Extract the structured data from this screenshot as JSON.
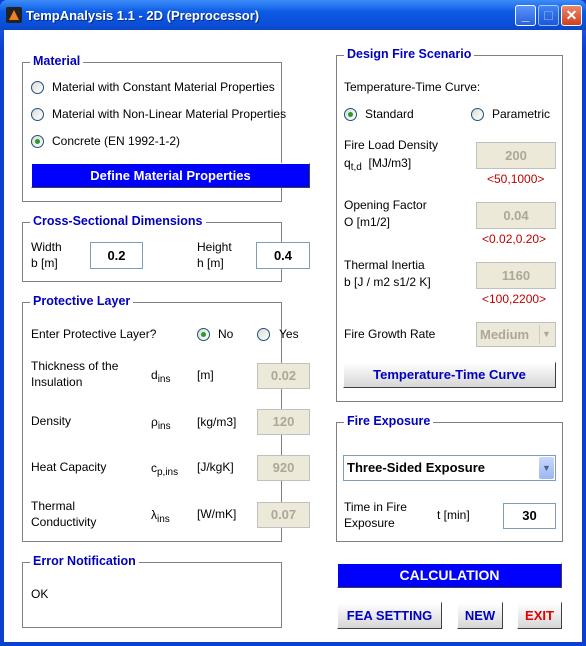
{
  "window": {
    "title": "TempAnalysis 1.1  -  2D (Preprocessor)",
    "controls": [
      "minimize",
      "maximize",
      "close"
    ]
  },
  "material": {
    "title": "Material",
    "options": [
      {
        "label": "Material with Constant Material Properties",
        "selected": false
      },
      {
        "label": "Material with Non-Linear Material Properties",
        "selected": false
      },
      {
        "label": "Concrete (EN 1992-1-2)",
        "selected": true
      }
    ],
    "define_button": "Define Material Properties"
  },
  "cross_section": {
    "title": "Cross-Sectional Dimensions",
    "width_label": "Width",
    "width_unit": "b [m]",
    "width_value": "0.2",
    "height_label": "Height",
    "height_unit": "h [m]",
    "height_value": "0.4"
  },
  "protective": {
    "title": "Protective Layer",
    "question": "Enter Protective Layer?",
    "no_label": "No",
    "yes_label": "Yes",
    "selected": "No",
    "rows": [
      {
        "label1": "Thickness of the",
        "label2": "Insulation",
        "sym": "d",
        "sub": "ins",
        "unit": "[m]",
        "value": "0.02"
      },
      {
        "label1": "Density",
        "label2": "",
        "sym": "ρ",
        "sub": "ins",
        "unit": "[kg/m3]",
        "value": "120"
      },
      {
        "label1": "Heat Capacity",
        "label2": "",
        "sym": "c",
        "sub": "p,ins",
        "unit": "[J/kgK]",
        "value": "920"
      },
      {
        "label1": "Thermal",
        "label2": "Conductivity",
        "sym": "λ",
        "sub": "ins",
        "unit": "[W/mK]",
        "value": "0.07"
      }
    ]
  },
  "error": {
    "title": "Error Notification",
    "message": "OK"
  },
  "fire": {
    "title": "Design Fire Scenario",
    "curve_label": "Temperature-Time Curve:",
    "standard": "Standard",
    "parametric": "Parametric",
    "selected": "Standard",
    "load_label": "Fire Load Density",
    "load_sym": "q",
    "load_sub": "t,d",
    "load_unit": "[MJ/m3]",
    "load_value": "200",
    "load_range": "<50,1000>",
    "opening_label": "Opening Factor",
    "opening_unit": "O [m1/2]",
    "opening_value": "0.04",
    "opening_range": "<0.02,0.20>",
    "inertia_label": "Thermal Inertia",
    "inertia_unit": "b [J / m2 s1/2 K]",
    "inertia_value": "1160",
    "inertia_range": "<100,2200>",
    "growth_label": "Fire Growth Rate",
    "growth_value": "Medium",
    "curve_button": "Temperature-Time Curve"
  },
  "exposure": {
    "title": "Fire Exposure",
    "selected": "Three-Sided Exposure",
    "time_label1": "Time in Fire",
    "time_label2": "Exposure",
    "time_unit": "t [min]",
    "time_value": "30"
  },
  "actions": {
    "calculation": "CALCULATION",
    "fea": "FEA SETTING",
    "new": "NEW",
    "exit": "EXIT"
  },
  "colors": {
    "accent": "#0000ff",
    "title_text": "#0000c0",
    "range_text": "#c00000",
    "exit_text": "#e00000"
  }
}
